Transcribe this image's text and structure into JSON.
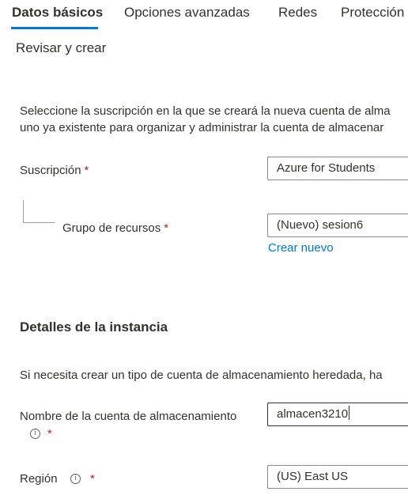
{
  "tabs": [
    {
      "label": "Datos básicos"
    },
    {
      "label": "Opciones avanzadas"
    },
    {
      "label": "Redes"
    },
    {
      "label": "Protección"
    },
    {
      "label": "Revisar y crear"
    }
  ],
  "project": {
    "description_line1": "Seleccione la suscripción en la que se creará la nueva cuenta de alma",
    "description_line2": "uno ya existente para organizar y administrar la cuenta de almacenar",
    "subscription": {
      "label": "Suscripción",
      "required": "*",
      "value": "Azure for Students"
    },
    "resource_group": {
      "label": "Grupo de recursos",
      "required": "*",
      "value": "(Nuevo) sesion6",
      "create_new_link": "Crear nuevo"
    }
  },
  "instance": {
    "title": "Detalles de la instancia",
    "description": "Si necesita crear un tipo de cuenta de almacenamiento heredada, ha",
    "storage_name": {
      "label": "Nombre de la cuenta de almacenamiento",
      "required": "*",
      "value": "almacen3210",
      "icon": "info-icon"
    },
    "region": {
      "label": "Región",
      "required": "*",
      "value": "(US) East US",
      "icon": "info-icon"
    }
  },
  "colors": {
    "accent": "#0078d4",
    "required": "#a4262c",
    "text": "#323130",
    "border": "#8a8886"
  }
}
